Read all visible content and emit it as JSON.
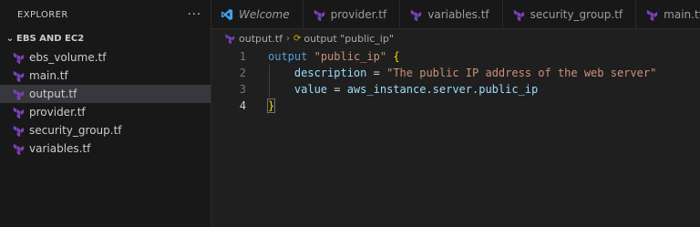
{
  "sidebar": {
    "title": "EXPLORER",
    "more_label": "···",
    "folder": "EBS AND EC2",
    "files": [
      {
        "name": "ebs_volume.tf",
        "active": false
      },
      {
        "name": "main.tf",
        "active": false
      },
      {
        "name": "output.tf",
        "active": true
      },
      {
        "name": "provider.tf",
        "active": false
      },
      {
        "name": "security_group.tf",
        "active": false
      },
      {
        "name": "variables.tf",
        "active": false
      }
    ]
  },
  "tabs": [
    {
      "label": "Welcome",
      "icon": "vscode-icon"
    },
    {
      "label": "provider.tf",
      "icon": "terraform-icon"
    },
    {
      "label": "variables.tf",
      "icon": "terraform-icon"
    },
    {
      "label": "security_group.tf",
      "icon": "terraform-icon"
    },
    {
      "label": "main.tf",
      "icon": "terraform-icon"
    }
  ],
  "breadcrumb": {
    "file": "output.tf",
    "symbol": "output \"public_ip\""
  },
  "code": {
    "line_numbers": [
      "1",
      "2",
      "3",
      "4"
    ],
    "line1": {
      "keyword": "output",
      "name": "\"public_ip\"",
      "brace": "{"
    },
    "line2": {
      "attr": "description",
      "eq": "=",
      "value": "\"The public IP address of the web server\""
    },
    "line3": {
      "attr": "value",
      "eq": "=",
      "value": "aws_instance.server.public_ip"
    },
    "line4": {
      "brace": "}"
    }
  },
  "colors": {
    "terraform": "#7b42bc",
    "vscode_blue": "#3ea6f2",
    "keyword": "#569cd6",
    "string": "#ce9178",
    "attribute": "#9cdcfe",
    "brace": "#ffd700"
  }
}
